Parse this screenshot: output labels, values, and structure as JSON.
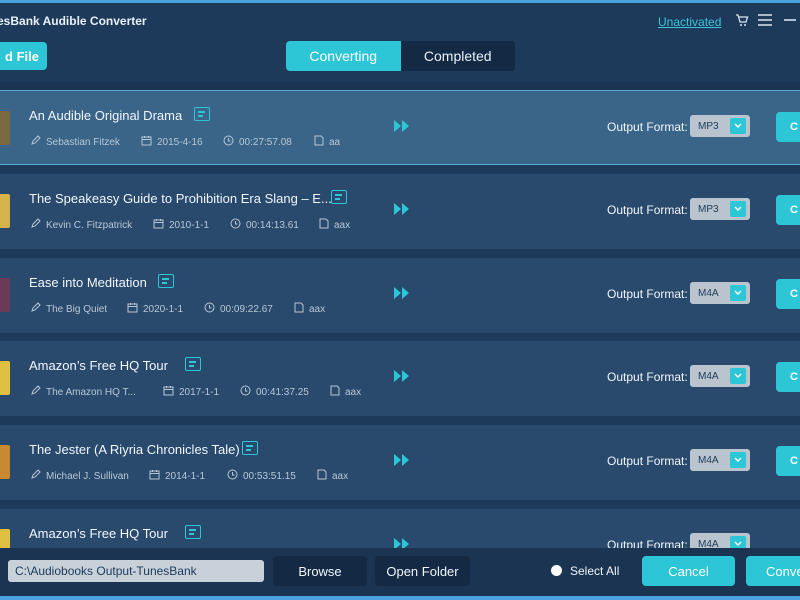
{
  "app": {
    "title": "esBank Audible Converter",
    "unactivated_label": "Unactivated"
  },
  "toolbar": {
    "add_file_label": "d File",
    "tabs": [
      {
        "label": "Converting",
        "active": true
      },
      {
        "label": "Completed",
        "active": false
      }
    ]
  },
  "rows": [
    {
      "title": "An Audible Original Drama",
      "author": "Sebastian Fitzek",
      "date": "2015-4-16",
      "duration": "00:27:57.08",
      "ext": "aa",
      "format": "MP3",
      "output_label": "Output Format:",
      "button_label": "C",
      "cover_color": "#7a6840",
      "selected": true
    },
    {
      "title": "The Speakeasy Guide to Prohibition Era Slang – E...",
      "author": "Kevin C. Fitzpatrick",
      "date": "2010-1-1",
      "duration": "00:14:13.61",
      "ext": "aax",
      "format": "MP3",
      "output_label": "Output Format:",
      "button_label": "C",
      "cover_color": "#d4b44a",
      "selected": false
    },
    {
      "title": "Ease into Meditation",
      "author": "The Big Quiet",
      "date": "2020-1-1",
      "duration": "00:09:22.67",
      "ext": "aax",
      "format": "M4A",
      "output_label": "Output Format:",
      "button_label": "C",
      "cover_color": "#6a3a56",
      "selected": false
    },
    {
      "title": "Amazon’s Free HQ Tour",
      "author": "The Amazon HQ T...",
      "date": "2017-1-1",
      "duration": "00:41:37.25",
      "ext": "aax",
      "format": "M4A",
      "output_label": "Output Format:",
      "button_label": "C",
      "cover_color": "#e0c040",
      "selected": false
    },
    {
      "title": "The Jester (A Riyria Chronicles Tale)",
      "author": "Michael J. Sullivan",
      "date": "2014-1-1",
      "duration": "00:53:51.15",
      "ext": "aax",
      "format": "M4A",
      "output_label": "Output Format:",
      "button_label": "C",
      "cover_color": "#c88a30",
      "selected": false
    },
    {
      "title": "Amazon’s Free HQ Tour",
      "author": "",
      "date": "",
      "duration": "",
      "ext": "",
      "format": "M4A",
      "output_label": "Output Format:",
      "button_label": "",
      "cover_color": "#e0c040",
      "selected": false
    }
  ],
  "footer": {
    "output_path": "C:\\Audiobooks Output-TunesBank",
    "browse_label": "Browse",
    "open_folder_label": "Open Folder",
    "select_all_label": "Select All",
    "cancel_label": "Cancel",
    "convert_label": "Conve"
  },
  "colors": {
    "accent": "#2cc6d6",
    "background": "#1d3a5a",
    "row": "#2a4a6d",
    "row_selected": "#3a6589",
    "dark_button": "#142a44"
  },
  "icons": [
    "cart-icon",
    "menu-icon",
    "minimize-icon",
    "info-icon",
    "author-icon",
    "calendar-icon",
    "clock-icon",
    "file-icon",
    "play-forward-icon",
    "chevron-down-icon"
  ]
}
